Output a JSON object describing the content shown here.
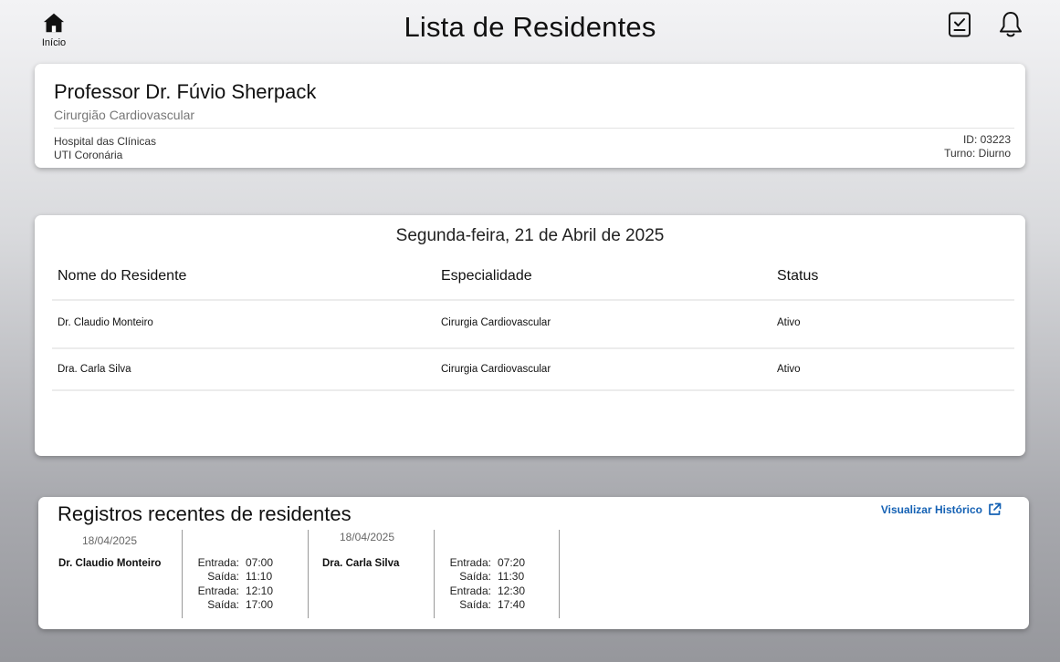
{
  "header": {
    "home_label": "Início",
    "title": "Lista de Residentes"
  },
  "profile": {
    "name": "Professor Dr. Fúvio Sherpack",
    "specialty": "Cirurgião Cardiovascular",
    "hospital": "Hospital das Clínicas",
    "unit": "UTI Coronária",
    "id": "ID: 03223",
    "shift": "Turno: Diurno"
  },
  "residents": {
    "date": "Segunda-feira, 21 de Abril de 2025",
    "columns": [
      "Nome do Residente",
      "Especialidade",
      "Status"
    ],
    "rows": [
      {
        "name": "Dr. Claudio Monteiro",
        "specialty": "Cirurgia Cardiovascular",
        "status": "Ativo"
      },
      {
        "name": "Dra. Carla Silva",
        "specialty": "Cirurgia Cardiovascular",
        "status": "Ativo"
      }
    ]
  },
  "records": {
    "title": "Registros recentes de residentes",
    "history_link": "Visualizar Histórico",
    "entries": [
      {
        "date": "18/04/2025",
        "name": "Dr. Claudio Monteiro",
        "times": [
          {
            "label": "Entrada:",
            "time": "07:00"
          },
          {
            "label": "Saída:",
            "time": "11:10"
          },
          {
            "label": "Entrada:",
            "time": "12:10"
          },
          {
            "label": "Saída:",
            "time": "17:00"
          }
        ]
      },
      {
        "date": "18/04/2025",
        "name": "Dra. Carla Silva",
        "times": [
          {
            "label": "Entrada:",
            "time": "07:20"
          },
          {
            "label": "Saída:",
            "time": "11:30"
          },
          {
            "label": "Entrada:",
            "time": "12:30"
          },
          {
            "label": "Saída:",
            "time": "17:40"
          }
        ]
      }
    ]
  },
  "icons": {
    "home": "home-icon",
    "clipboard": "clipboard-check-icon",
    "bell": "bell-icon",
    "external": "external-link-icon"
  },
  "colors": {
    "link": "#1461b4"
  }
}
